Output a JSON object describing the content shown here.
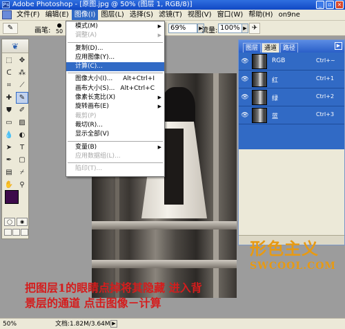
{
  "window": {
    "title": "Adobe Photoshop - [原图.jpg @ 50% (图层 1, RGB/8)]",
    "buttons": [
      "_",
      "▫",
      "×"
    ]
  },
  "menubar": {
    "items": [
      "文件(F)",
      "编辑(E)",
      "图像(I)",
      "图层(L)",
      "选择(S)",
      "滤镜(T)",
      "视图(V)",
      "窗口(W)",
      "帮助(H)",
      "on9ne"
    ]
  },
  "options": {
    "brush_label": "画笔:",
    "brush_size": "50",
    "zoom_value": "69%",
    "flow_label": "流量:",
    "flow_value": "100%"
  },
  "image_menu": {
    "items": [
      {
        "label": "模式(M)",
        "submenu": true,
        "enabled": true
      },
      {
        "label": "调整(A)",
        "submenu": true,
        "enabled": false
      },
      {
        "sep": true
      },
      {
        "label": "复制(D)...",
        "enabled": true
      },
      {
        "label": "应用图像(Y)...",
        "enabled": true
      },
      {
        "label": "计算(C)...",
        "enabled": true,
        "highlighted": true
      },
      {
        "sep": true
      },
      {
        "label": "图像大小(I)...",
        "shortcut": "Alt+Ctrl+I",
        "enabled": true
      },
      {
        "label": "画布大小(S)...",
        "shortcut": "Alt+Ctrl+C",
        "enabled": true
      },
      {
        "label": "像素长宽比(X)",
        "submenu": true,
        "enabled": true
      },
      {
        "label": "旋转画布(E)",
        "submenu": true,
        "enabled": true
      },
      {
        "label": "裁剪(P)",
        "enabled": false
      },
      {
        "label": "裁切(R)...",
        "enabled": true
      },
      {
        "label": "显示全部(V)",
        "enabled": true
      },
      {
        "sep": true
      },
      {
        "label": "变量(B)",
        "submenu": true,
        "enabled": true
      },
      {
        "label": "应用数据组(L)...",
        "enabled": false
      },
      {
        "sep": true
      },
      {
        "label": "陷印(T)...",
        "enabled": false
      }
    ]
  },
  "channels_panel": {
    "tabs": [
      "图层",
      "通道",
      "路径"
    ],
    "active_tab": 1,
    "channels": [
      {
        "name": "RGB",
        "shortcut": "Ctrl+~"
      },
      {
        "name": "红",
        "shortcut": "Ctrl+1"
      },
      {
        "name": "绿",
        "shortcut": "Ctrl+2"
      },
      {
        "name": "蓝",
        "shortcut": "Ctrl+3"
      }
    ],
    "selection_color": "#316ac5"
  },
  "colors": {
    "foreground": "#3d0a4a",
    "background": "#ffffff"
  },
  "watermark": {
    "cn": "形色主义",
    "en": "SWCOOL.COM",
    "color": "#e89a12"
  },
  "caption": {
    "line1": "把图层1的眼睛点掉将其隐藏 进入背",
    "line2": "景层的通道 点击图像－计算",
    "color": "#d41d1d"
  },
  "status": {
    "zoom": "50%",
    "doc": "文档:1.82M/3.64M"
  }
}
